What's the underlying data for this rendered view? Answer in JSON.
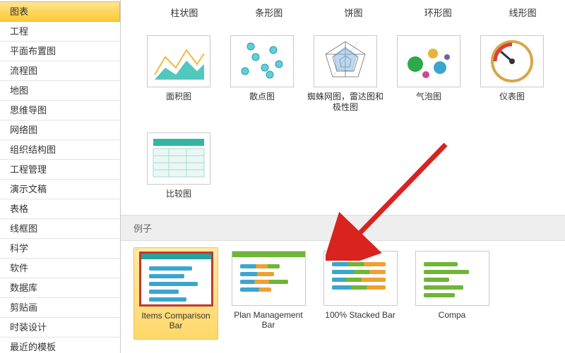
{
  "sidebar": {
    "items": [
      {
        "label": "图表",
        "selected": true
      },
      {
        "label": "工程"
      },
      {
        "label": "平面布置图"
      },
      {
        "label": "流程图"
      },
      {
        "label": "地图"
      },
      {
        "label": "思维导图"
      },
      {
        "label": "网络图"
      },
      {
        "label": "组织结构图"
      },
      {
        "label": "工程管理"
      },
      {
        "label": "演示文稿"
      },
      {
        "label": "表格"
      },
      {
        "label": "线框图"
      },
      {
        "label": "科学"
      },
      {
        "label": "软件"
      },
      {
        "label": "数据库"
      },
      {
        "label": "剪贴画"
      },
      {
        "label": "时装设计"
      },
      {
        "label": "最近的模板"
      }
    ]
  },
  "top_row_labels": [
    "柱状图",
    "条形图",
    "饼图",
    "环形图",
    "线形图"
  ],
  "charts_row2": [
    {
      "label": "面积图",
      "name": "area-chart-icon"
    },
    {
      "label": "散点图",
      "name": "scatter-chart-icon"
    },
    {
      "label": "蜘蛛网图，雷达图和极性图",
      "name": "radar-chart-icon"
    },
    {
      "label": "气泡图",
      "name": "bubble-chart-icon"
    },
    {
      "label": "仪表图",
      "name": "gauge-chart-icon"
    }
  ],
  "charts_row3": [
    {
      "label": "比较图",
      "name": "comparison-chart-icon"
    }
  ],
  "examples_section_title": "例子",
  "examples": [
    {
      "label": "Items Comparison Bar",
      "name": "example-items-comparison-bar",
      "selected": true
    },
    {
      "label": "Plan Management Bar",
      "name": "example-plan-management-bar"
    },
    {
      "label": "100% Stacked Bar",
      "name": "example-100-stacked-bar"
    },
    {
      "label": "Compa",
      "name": "example-comparison-bar"
    }
  ]
}
